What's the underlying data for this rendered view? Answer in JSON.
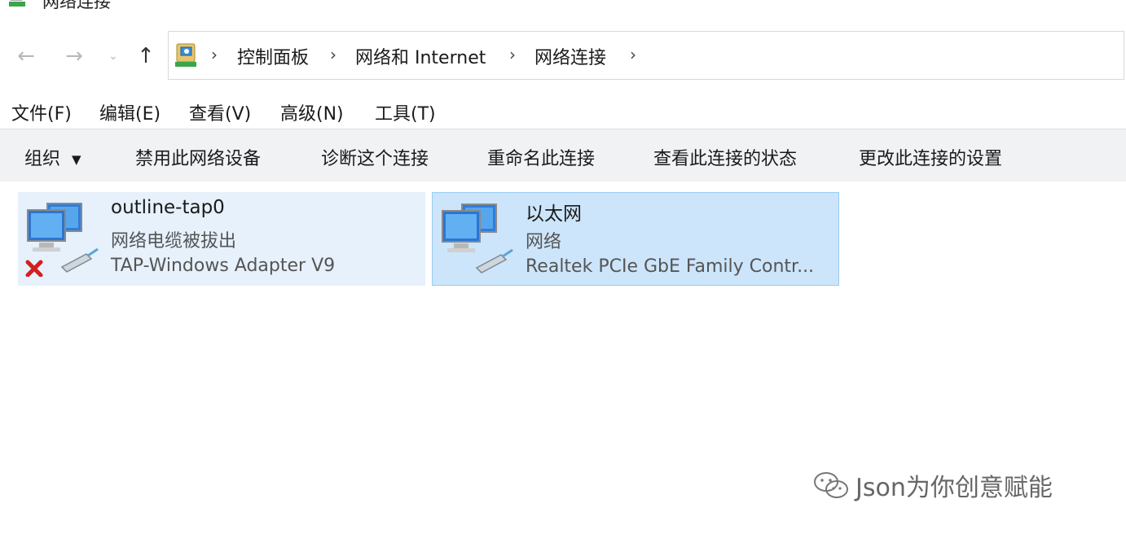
{
  "window": {
    "title": "网络连接"
  },
  "nav": {
    "back_icon": "arrow-left-icon",
    "forward_icon": "arrow-right-icon",
    "recent_icon": "chevron-down-icon",
    "up_icon": "arrow-up-icon"
  },
  "address": {
    "icon": "control-panel-icon",
    "crumbs": [
      "控制面板",
      "网络和 Internet",
      "网络连接"
    ]
  },
  "menu": {
    "items": [
      "文件(F)",
      "编辑(E)",
      "查看(V)",
      "高级(N)",
      "工具(T)"
    ]
  },
  "toolbar": {
    "organize": "组织",
    "commands": [
      "禁用此网络设备",
      "诊断这个连接",
      "重命名此连接",
      "查看此连接的状态",
      "更改此连接的设置"
    ]
  },
  "connections": [
    {
      "name": "outline-tap0",
      "status": "网络电缆被拔出",
      "device": "TAP-Windows Adapter V9",
      "icon": "network-disconnected-icon",
      "selected": false
    },
    {
      "name": "以太网",
      "status": "网络",
      "device": "Realtek PCIe GbE Family Contr...",
      "icon": "network-adapter-icon",
      "selected": true
    }
  ],
  "watermark": {
    "text": "Json为你创意赋能"
  },
  "colors": {
    "selected_bg": "#cce5fb",
    "hover_bg": "#e6f1fb",
    "selected_border": "#99ccf5",
    "toolbar_bg": "#f1f2f4"
  }
}
